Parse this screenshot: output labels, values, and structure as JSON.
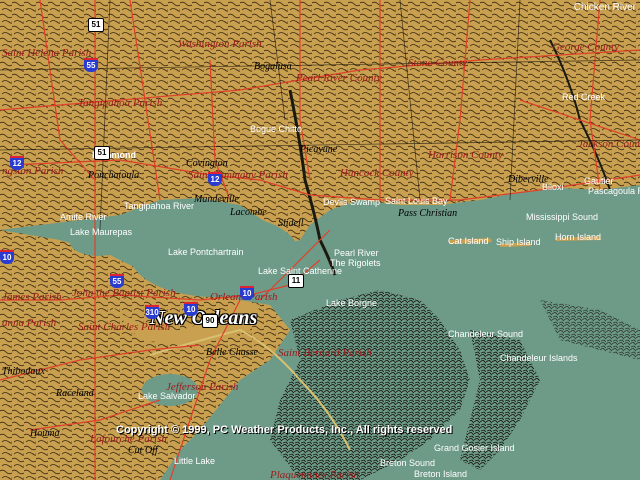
{
  "labels": {
    "saint_helena_parish": "Saint Helena Parish",
    "washington_parish": "Washington Parish",
    "bogalusa": "Bogalusa",
    "pearl_river_county": "Pearl River County",
    "stone_county": "Stone County",
    "george_county": "George County",
    "chicken_river": "Chicken River",
    "red_creek": "Red Creek",
    "tangipahoa_parish": "Tangipahoa Parish",
    "bogue_chitto": "Bogue Chitto",
    "picayune": "Picayune",
    "harrison_county": "Harrison County",
    "jackson_county": "Jackson County",
    "hancock_county": "Hancock County",
    "saint_tammany_parish": "Saint Tammany Parish",
    "covington": "Covington",
    "ponchatoula": "Ponchatoula",
    "hammond": "Hammond",
    "livingston_parish": "ngston Parish",
    "mandeville": "Mandeville",
    "lacombe": "Lacombe",
    "slidell": "Slidell",
    "tangipahoa_river": "Tangipahoa River",
    "amite_river": "Amite River",
    "lake_maurepas": "Lake Maurepas",
    "devils_swamp": "Devils Swamp",
    "saint_louis_bay": "Saint Louis Bay",
    "pass_christian": "Pass Christian",
    "diberville": "Diberville",
    "biloxi": "Biloxi",
    "gautier": "Gautier",
    "pascagoula_river": "Pascagoula River",
    "mississippi_sound": "Mississippi Sound",
    "cat_island": "Cat Island",
    "ship_island": "Ship Island",
    "horn_island": "Horn Island",
    "lake_pontchartrain": "Lake Pontchartrain",
    "pearl_river": "Pearl River",
    "the_rigolets": "The Rigolets",
    "lake_saint_catherine": "Lake Saint Catherine",
    "james_parish": "James Parish",
    "john_parish": "John the Baptist Parish",
    "orleans_parish": "Orleans Parish",
    "new_orleans": "New Orleans",
    "anna_parish": "anna Parish",
    "charles_parish": "Saint Charles Parish",
    "lake_borgne": "Lake Borgne",
    "chandeleur_sound": "Chandeleur Sound",
    "chandeleur_islands": "Chandeleur Islands",
    "belle_chasse": "Belle Chasse",
    "saint_bernard_parish": "Saint Bernard Parish",
    "thibodaux": "Thibodaux",
    "raceland": "Raceland",
    "jefferson_parish": "Jefferson Parish",
    "lake_salvador": "Lake Salvador",
    "lafourche_parish": "Lafourche Parish",
    "cut_off": "Cut Off",
    "houma": "Houma",
    "little_lake": "Little Lake",
    "grand_gosier": "Grand Gosier Island",
    "breton_sound": "Breton Sound",
    "breton_island": "Breton Island",
    "plaquemines_parish": "Plaquemines Parish",
    "copyright": "Copyright © 1999, PC Weather Products, Inc., All rights reserved"
  },
  "shields": {
    "i12a": "12",
    "i12b": "12",
    "i55": "55",
    "i10a": "10",
    "i10b": "10",
    "i10c": "10",
    "us51a": "51",
    "us51b": "51",
    "us11": "11",
    "us90": "90",
    "i310": "310",
    "i55b": "55"
  },
  "colors": {
    "land": "#c8a050",
    "water": "#6e9a88",
    "roads": "#e0402a",
    "boundaries": "#000000"
  }
}
